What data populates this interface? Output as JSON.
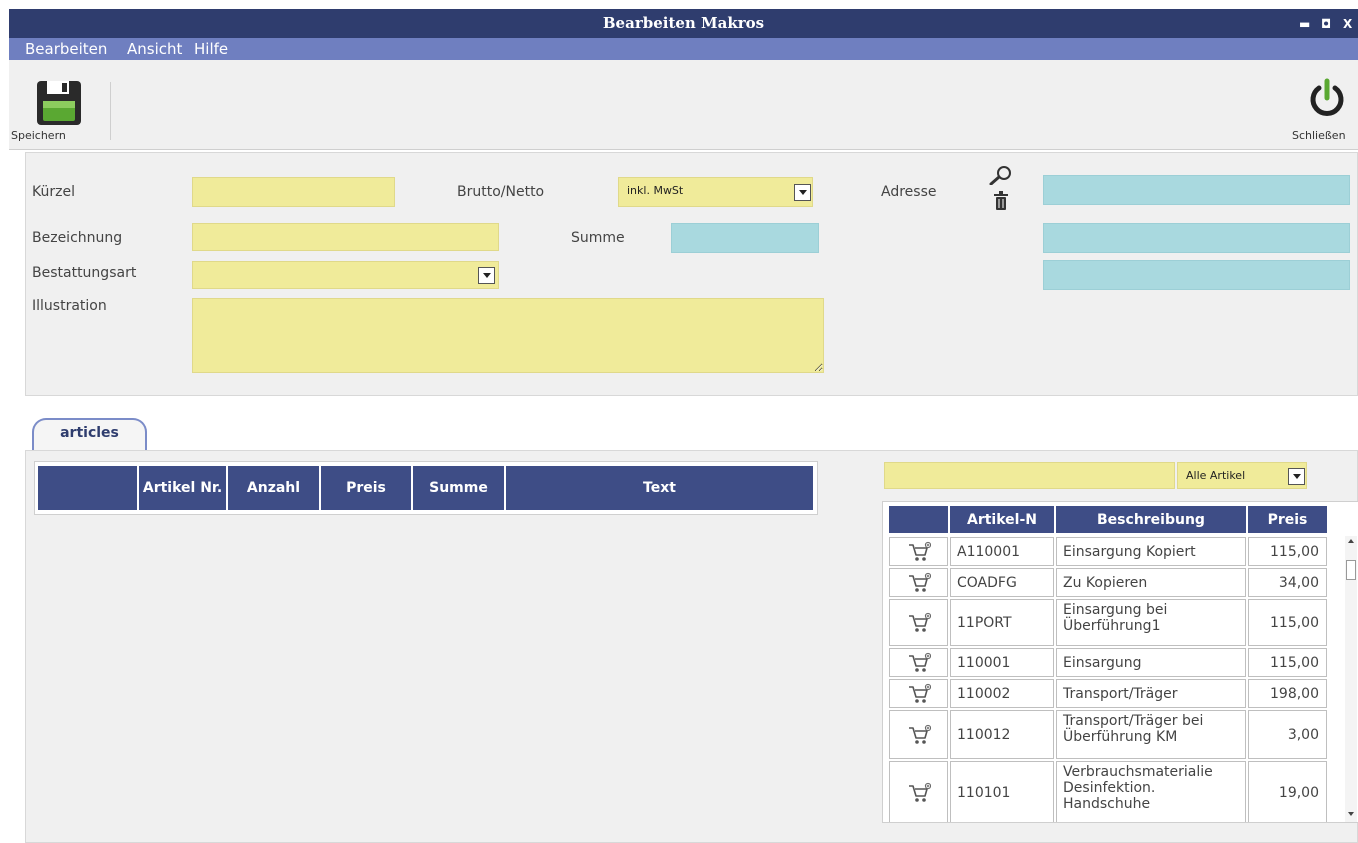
{
  "window": {
    "title": "Bearbeiten Makros",
    "minimize": "▬",
    "maximize": "◘",
    "close": "X"
  },
  "menu": [
    "Bearbeiten",
    "Ansicht",
    "Hilfe"
  ],
  "toolbar": {
    "save_label": "Speichern",
    "close_label": "Schließen"
  },
  "form": {
    "kuerzel_label": "Kürzel",
    "brutto_netto_label": "Brutto/Netto",
    "brutto_netto_value": "inkl. MwSt",
    "adresse_label": "Adresse",
    "bezeichnung_label": "Bezeichnung",
    "summe_label": "Summe",
    "bestattungsart_label": "Bestattungsart",
    "illustration_label": "Illustration",
    "colors": {
      "field": "#f0eb9a",
      "readonly": "#a9d9df"
    }
  },
  "tab": {
    "label": "articles"
  },
  "left_table": {
    "headers": [
      "",
      "Artikel Nr.",
      "Anzahl",
      "Preis",
      "Summe",
      "Text"
    ]
  },
  "filter": {
    "search_value": "",
    "select_value": "Alle Artikel"
  },
  "right_table": {
    "headers": [
      "",
      "Artikel-N",
      "Beschreibung",
      "Preis"
    ],
    "rows": [
      {
        "nr": "A110001",
        "desc": "Einsargung Kopiert",
        "price": "115,00"
      },
      {
        "nr": "COADFG",
        "desc": "Zu Kopieren",
        "price": "34,00"
      },
      {
        "nr": "11PORT",
        "desc": "Einsargung bei Überführung1",
        "price": "115,00"
      },
      {
        "nr": "110001",
        "desc": "Einsargung",
        "price": "115,00"
      },
      {
        "nr": "110002",
        "desc": "Transport/Träger",
        "price": "198,00"
      },
      {
        "nr": "110012",
        "desc": "Transport/Träger bei Überführung KM",
        "price": "3,00"
      },
      {
        "nr": "110101",
        "desc": "Verbrauchsmaterialie Desinfektion. Handschuhe",
        "price": "19,00"
      }
    ]
  },
  "colors": {
    "titlebar": "#2f3d6e",
    "menubar": "#6f7fc0",
    "header": "#3e4d86"
  }
}
